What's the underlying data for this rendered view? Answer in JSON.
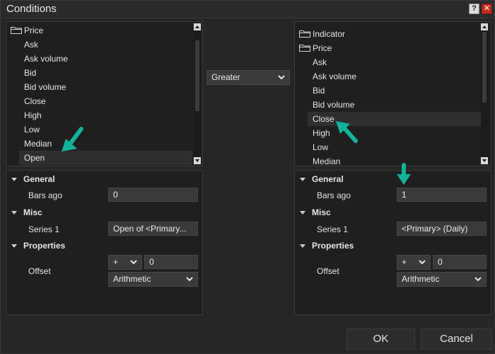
{
  "window": {
    "title": "Conditions",
    "help_label": "?",
    "close_label": "✕"
  },
  "left_list": {
    "folder_label": "Price",
    "items": [
      "Ask",
      "Ask volume",
      "Bid",
      "Bid volume",
      "Close",
      "High",
      "Low",
      "Median",
      "Open"
    ],
    "selected": "Open"
  },
  "operator": {
    "value": "Greater"
  },
  "right_list": {
    "folder_indicator": "Indicator",
    "folder_price": "Price",
    "items": [
      "Ask",
      "Ask volume",
      "Bid",
      "Bid volume",
      "Close",
      "High",
      "Low",
      "Median"
    ],
    "selected": "Close"
  },
  "left_props": {
    "general": "General",
    "bars_ago_label": "Bars ago",
    "bars_ago_value": "0",
    "misc": "Misc",
    "series_label": "Series 1",
    "series_value": "Open of <Primary...",
    "properties": "Properties",
    "offset_label": "Offset",
    "offset_sign": "+",
    "offset_value": "0",
    "offset_type": "Arithmetic"
  },
  "right_props": {
    "general": "General",
    "bars_ago_label": "Bars ago",
    "bars_ago_value": "1",
    "misc": "Misc",
    "series_label": "Series 1",
    "series_value": "<Primary> (Daily)",
    "properties": "Properties",
    "offset_label": "Offset",
    "offset_sign": "+",
    "offset_value": "0",
    "offset_type": "Arithmetic"
  },
  "buttons": {
    "ok": "OK",
    "cancel": "Cancel"
  },
  "colors": {
    "annotation_arrow": "#12b39a",
    "close_button": "#c42b1c",
    "background": "#262626"
  }
}
